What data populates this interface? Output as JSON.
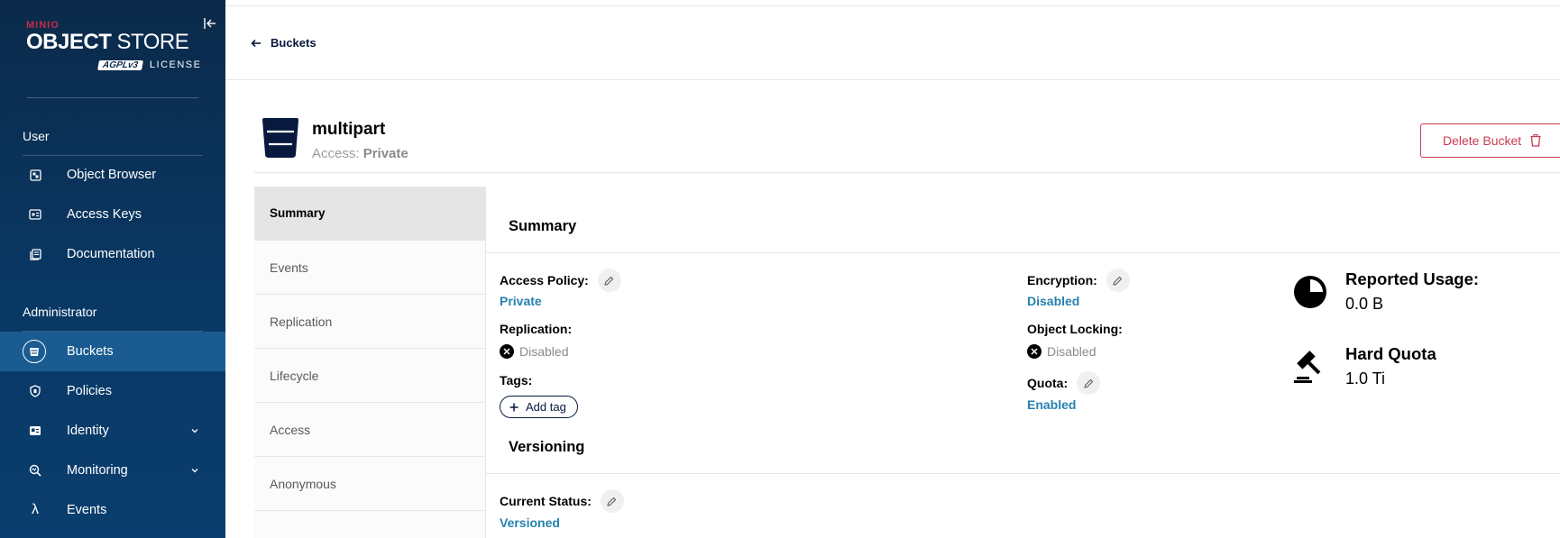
{
  "brand": {
    "minio": "MINIO",
    "title_bold": "OBJECT",
    "title_rest": " STORE",
    "agpl": "AGPLv3",
    "license": "LICENSE"
  },
  "sidebar": {
    "user_section": "User",
    "admin_section": "Administrator",
    "user_items": [
      {
        "label": "Object Browser",
        "icon": "object-browser-icon"
      },
      {
        "label": "Access Keys",
        "icon": "access-keys-icon"
      },
      {
        "label": "Documentation",
        "icon": "documentation-icon"
      }
    ],
    "admin_items": [
      {
        "label": "Buckets",
        "icon": "buckets-icon",
        "active": true
      },
      {
        "label": "Policies",
        "icon": "policies-icon"
      },
      {
        "label": "Identity",
        "icon": "identity-icon",
        "expandable": true
      },
      {
        "label": "Monitoring",
        "icon": "monitoring-icon",
        "expandable": true
      },
      {
        "label": "Events",
        "icon": "lambda-icon"
      }
    ]
  },
  "header": {
    "back_label": "Buckets"
  },
  "bucket": {
    "name": "multipart",
    "access_prefix": "Access: ",
    "access_value": "Private",
    "delete_label": "Delete Bucket"
  },
  "tabs": [
    "Summary",
    "Events",
    "Replication",
    "Lifecycle",
    "Access",
    "Anonymous"
  ],
  "summary": {
    "title": "Summary",
    "access_policy_label": "Access Policy:",
    "access_policy_value": "Private",
    "replication_label": "Replication:",
    "replication_value": "Disabled",
    "tags_label": "Tags:",
    "add_tag_label": "Add tag",
    "encryption_label": "Encryption:",
    "encryption_value": "Disabled",
    "object_locking_label": "Object Locking:",
    "object_locking_value": "Disabled",
    "quota_label": "Quota:",
    "quota_value": "Enabled",
    "reported_usage_label": "Reported Usage:",
    "reported_usage_value": "0.0 B",
    "hard_quota_label": "Hard Quota",
    "hard_quota_value": "1.0 Ti"
  },
  "versioning": {
    "title": "Versioning",
    "current_status_label": "Current Status:",
    "current_status_value": "Versioned"
  },
  "colors": {
    "sidebar_bg": "#093864",
    "link_blue": "#2781b0",
    "danger": "#c83b51",
    "navy": "#07193e"
  }
}
